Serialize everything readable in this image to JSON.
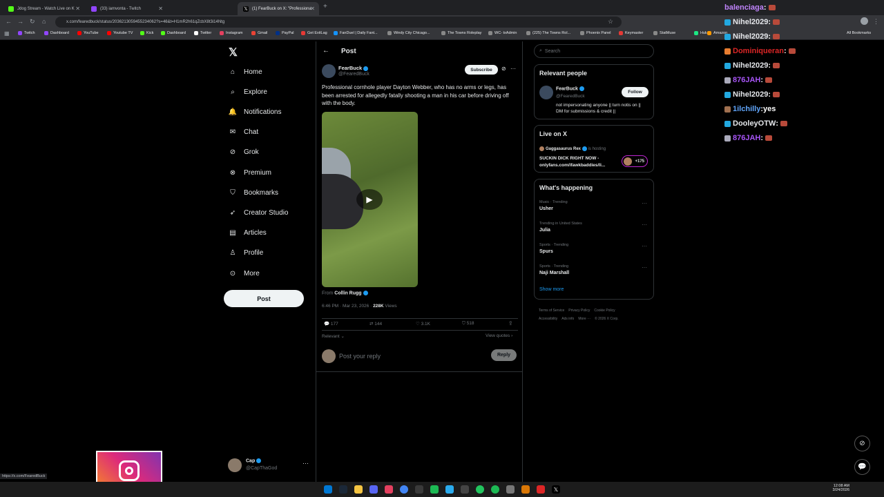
{
  "tabs": [
    {
      "label": "Jdog Stream - Watch Live on K",
      "color": "#53fc18"
    },
    {
      "label": "(33) iamvonta - Twitch",
      "color": "#9146ff"
    },
    {
      "label": "(1) FearBuck on X: \"Professiona",
      "color": "#ffffff"
    }
  ],
  "url": "x.com/fearedbuck/status/2036213059455234062?s=46&t=H1mR2h61qZcbX8t3i14Ntg",
  "bookmarks": [
    "Twitch",
    "Dashboard",
    "YouTube",
    "Youtube TV",
    "Kick",
    "Dashboard",
    "Twitter",
    "Instagram",
    "Gmail",
    "PayPal",
    "Get ExitLag",
    "FanDuel | Daily Fant...",
    "Windy City Chicago...",
    "The Towns Roleplay",
    "WC- txAdmin",
    "(225) The Towns Rol...",
    "Phoenix Panel",
    "Keymaster",
    "StatMuse",
    "Hulu",
    "Amazon"
  ],
  "all_bookmarks": "All Bookmarks",
  "nav": [
    {
      "label": "Home",
      "icon": "home-icon"
    },
    {
      "label": "Explore",
      "icon": "search-icon"
    },
    {
      "label": "Notifications",
      "icon": "bell-icon"
    },
    {
      "label": "Chat",
      "icon": "mail-icon"
    },
    {
      "label": "Grok",
      "icon": "grok-icon"
    },
    {
      "label": "Premium",
      "icon": "x-premium-icon"
    },
    {
      "label": "Bookmarks",
      "icon": "bookmark-icon"
    },
    {
      "label": "Creator Studio",
      "icon": "rocket-icon"
    },
    {
      "label": "Articles",
      "icon": "document-icon"
    },
    {
      "label": "Profile",
      "icon": "person-icon"
    },
    {
      "label": "More",
      "icon": "more-circle-icon"
    }
  ],
  "post_button": "Post",
  "account": {
    "name": "Cap",
    "handle": "@CapThaGod"
  },
  "status_url": "https://x.com/FearedBuck",
  "post": {
    "header": "Post",
    "author": "FearBuck",
    "handle": "@FearedBuck",
    "subscribe": "Subscribe",
    "text": "Professional cornhole player Dayton Webber, who has no arms or legs, has been arrested for allegedly fatally shooting a man in his car before driving off with the body.",
    "from_label": "From",
    "from_name": "Collin Rugg",
    "time": "6:46 PM · Mar 23, 2026 · ",
    "views_count": "228K",
    "views_label": " Views",
    "replies": "177",
    "reposts": "144",
    "likes": "3.1K",
    "bookmarks": "518",
    "relevant": "Relevant",
    "view_quotes": "View quotes",
    "reply_placeholder": "Post your reply",
    "reply_button": "Reply"
  },
  "search_placeholder": "Search",
  "relevant_people": {
    "title": "Relevant people",
    "name": "FearBuck",
    "handle": "@FearedBuck",
    "follow": "Follow",
    "bio": "not impersonating anyone || turn notis on || DM for submissions & credit ||"
  },
  "live": {
    "title": "Live on X",
    "host": "Gaggasaurus Rex",
    "hosting": " is hosting",
    "stream_title": "SUCKIN DICK RIGHT NOW - onlyfans.com/ifawkbaddies/li...",
    "listeners": "+175"
  },
  "trending": {
    "title": "What's happening",
    "items": [
      {
        "meta": "Music · Trending",
        "topic": "Usher"
      },
      {
        "meta": "Trending in United States",
        "topic": "Julia"
      },
      {
        "meta": "Sports · Trending",
        "topic": "Spurs"
      },
      {
        "meta": "Sports · Trending",
        "topic": "Naji Marshall"
      }
    ],
    "show_more": "Show more"
  },
  "footer": [
    "Terms of Service",
    "Privacy Policy",
    "Cookie Policy",
    "Accessibility",
    "Ads info",
    "More ···",
    "© 2026 X Corp."
  ],
  "chat": [
    {
      "user": "balenciaga",
      "color": "#c084fc",
      "msg": ""
    },
    {
      "user": "Nihel2029",
      "color": "#e5e7eb",
      "msg": ""
    },
    {
      "user": "Nihel2029",
      "color": "#e5e7eb",
      "msg": ""
    },
    {
      "user": "Dominiqueran",
      "color": "#dc2626",
      "msg": ""
    },
    {
      "user": "Nihel2029",
      "color": "#e5e7eb",
      "msg": ""
    },
    {
      "user": "876JAH",
      "color": "#a855f7",
      "msg": ""
    },
    {
      "user": "Nihel2029",
      "color": "#e5e7eb",
      "msg": ""
    },
    {
      "user": "1ilchilly",
      "color": "#60a5fa",
      "msg": " yes"
    },
    {
      "user": "DooleyOTW",
      "color": "#e5e7eb",
      "msg": ""
    },
    {
      "user": "876JAH",
      "color": "#a855f7",
      "msg": ""
    }
  ],
  "clock": {
    "time": "12:08 AM",
    "date": "3/24/2026"
  }
}
